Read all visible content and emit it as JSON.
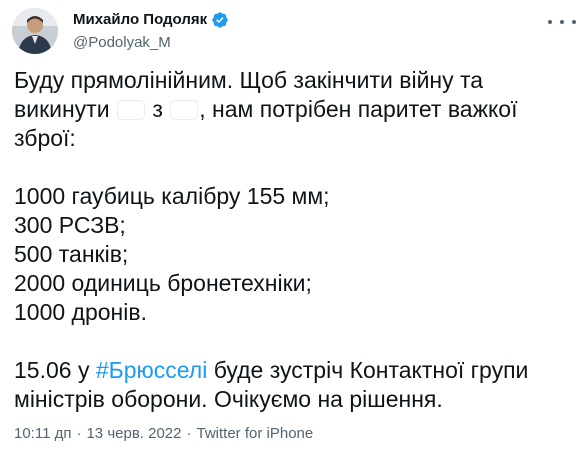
{
  "author": {
    "name": "Михайло Подоляк",
    "handle": "@Podolyak_M",
    "verified_color": "#1d9bf0"
  },
  "tweet": {
    "line1": "Буду прямолінійним. Щоб закінчити війну та",
    "line2_before": "викинути ",
    "line2_mid": " з ",
    "line2_after": ", нам потрібен паритет важкої",
    "line3": "зброї:",
    "list": [
      "1000 гаубиць калібру 155 мм;",
      "300 РСЗВ;",
      "500 танків;",
      "2000 одиниць бронетехніки;",
      "1000 дронів."
    ],
    "closing_prefix": "15.06 у ",
    "hashtag": "#Брюсселі",
    "closing_suffix": " буде зустріч Контактної групи",
    "closing_line2": "міністрів оборони. Очікуємо на рішення.",
    "flags": {
      "first": {
        "name": "russia-flag-emoji",
        "colors": [
          "#ffffff",
          "#1c57a7",
          "#d52b1e"
        ]
      },
      "second": {
        "name": "ukraine-flag-emoji",
        "colors": [
          "#1f63c6",
          "#ffd600"
        ]
      }
    }
  },
  "meta": {
    "time": "10:11 дп",
    "date": "13 черв. 2022",
    "separator": "·",
    "source": "Twitter for iPhone"
  }
}
